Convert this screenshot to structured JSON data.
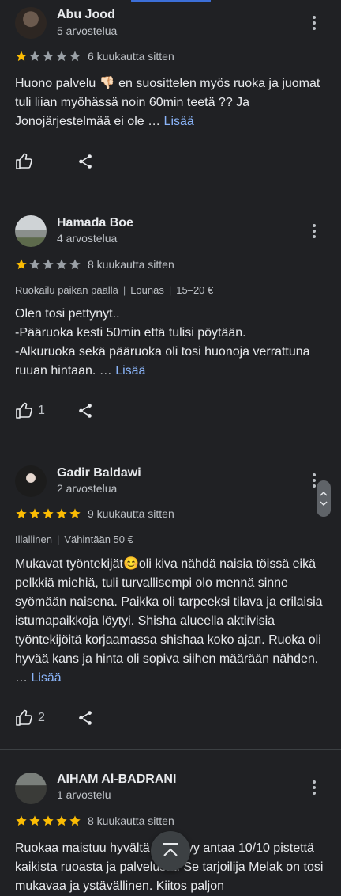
{
  "colors": {
    "background": "#202124",
    "link": "#8ab4f8",
    "star_filled": "#fbbc04",
    "star_empty": "#9aa0a6"
  },
  "more_label": "Lisää",
  "reviews": [
    {
      "name": "Abu Jood",
      "review_count": "5 arvostelua",
      "rating": 1,
      "date": "6 kuukautta sitten",
      "meta": [],
      "text": "Huono palvelu 👎🏻 en suosittelen myös ruoka ja juomat tuli liian myöhässä noin 60min teetä ?? Ja Jonojärjestelmää ei ole … ",
      "likes": ""
    },
    {
      "name": "Hamada Boe",
      "review_count": "4 arvostelua",
      "rating": 1,
      "date": "8 kuukautta sitten",
      "meta": [
        "Ruokailu paikan päällä",
        "Lounas",
        "15–20 €"
      ],
      "text": "Olen tosi pettynyt..\n-Pääruoka kesti 50min että tulisi pöytään.\n-Alkuruoka sekä pääruoka oli tosi huonoja verrattuna ruuan hintaan. … ",
      "likes": "1"
    },
    {
      "name": "Gadir Baldawi",
      "review_count": "2 arvostelua",
      "rating": 5,
      "date": "9 kuukautta sitten",
      "meta": [
        "Illallinen",
        "Vähintään 50 €"
      ],
      "text": "Mukavat työntekijät😊oli kiva nähdä naisia töissä eikä pelkkiä miehiä, tuli turvallisempi olo mennä sinne syömään naisena. Paikka oli tarpeeksi tilava ja erilaisia istumapaikkoja löytyi. Shisha alueella aktiivisia työntekijöitä korjaamassa shishaa koko ajan. Ruoka oli hyvää kans ja hinta oli sopiva siihen määrään nähden. … ",
      "likes": "2"
    },
    {
      "name": "AIHAM Al-BADRANI",
      "review_count": "1 arvostelu",
      "rating": 5,
      "date": "8 kuukautta sitten",
      "meta": [],
      "text": "Ruokaa maistuu hyvältä ja täytyy antaa 10/10 pistettä kaikista ruoasta ja palvelusta. Se tarjoilija Melak on tosi mukavaa ja ystävällinen. Kiitos paljon",
      "likes": ""
    }
  ]
}
